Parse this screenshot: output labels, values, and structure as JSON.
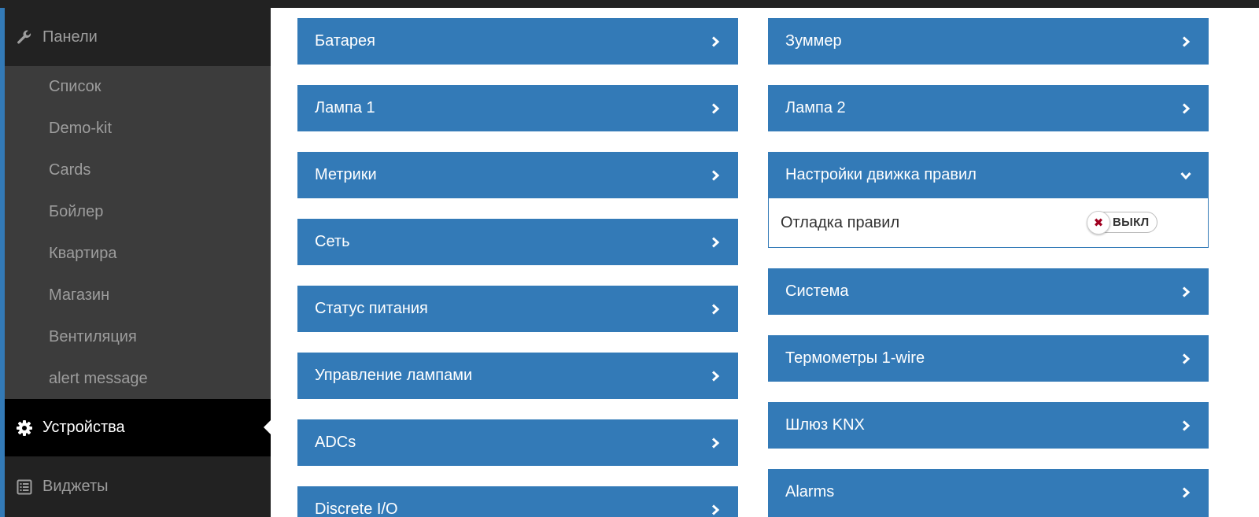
{
  "sidebar": {
    "panels_label": "Панели",
    "panels_icon": "wrench-icon",
    "submenu": [
      "Список",
      "Demo-kit",
      "Cards",
      "Бойлер",
      "Квартира",
      "Магазин",
      "Вентиляция",
      "alert message"
    ],
    "devices_label": "Устройства",
    "devices_icon": "gear-icon",
    "widgets_label": "Виджеты",
    "widgets_icon": "list-icon"
  },
  "left_column": [
    "Батарея",
    "Лампа 1",
    "Метрики",
    "Сеть",
    "Статус питания",
    "Управление лампами",
    "ADCs",
    "Discrete I/O"
  ],
  "right_column": {
    "before": [
      "Зуммер",
      "Лампа 2"
    ],
    "expanded": {
      "title": "Настройки движка правил",
      "row_label": "Отладка правил",
      "toggle_text": "ВЫКЛ",
      "toggle_state": "off"
    },
    "after": [
      "Система",
      "Термометры 1-wire",
      "Шлюз KNX",
      "Alarms"
    ]
  },
  "colors": {
    "accent": "#337ab7",
    "sidebar_bg": "#222222",
    "submenu_bg": "#3c3c3c",
    "active_bg": "#000000",
    "toggle_off_icon": "#a00020"
  }
}
